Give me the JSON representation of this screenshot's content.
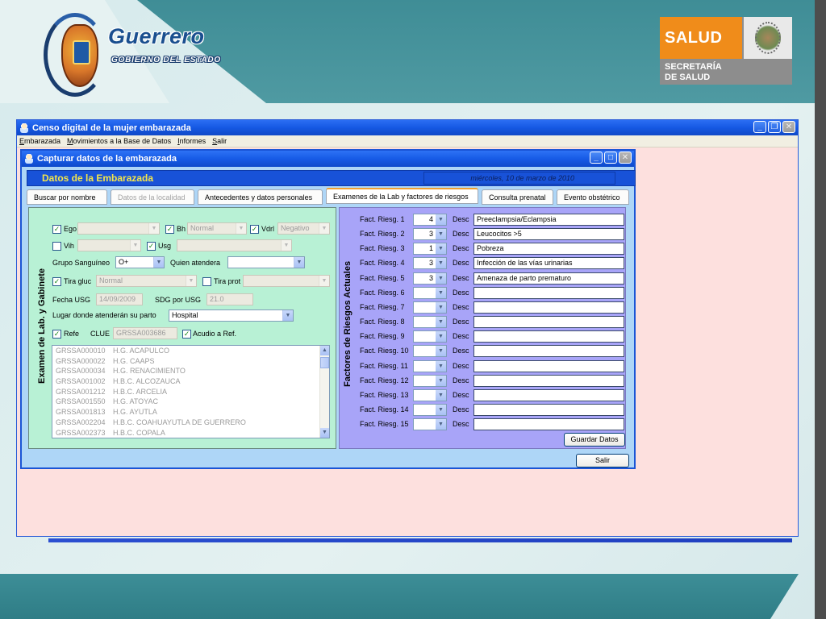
{
  "slide": {
    "guerrero_title": "Guerrero",
    "guerrero_subtitle": "GOBIERNO DEL ESTADO",
    "salud_word": "SALUD",
    "salud_secretaria_1": "SECRETARÍA",
    "salud_secretaria_2": "DE SALUD"
  },
  "main_window": {
    "title": "Censo digital de la mujer embarazada",
    "menu": [
      "Embarazada",
      "Movimientos a la Base de Datos",
      "Informes",
      "Salir"
    ]
  },
  "dialog": {
    "title": "Capturar datos de la embarazada",
    "banner_title": "Datos de la Embarazada",
    "banner_date": "miércoles, 10 de marzo de 2010",
    "tabs": [
      {
        "label": "Buscar por nombre"
      },
      {
        "label": "Datos de la localidad"
      },
      {
        "label": "Antecedentes y datos personales"
      },
      {
        "label": "Examenes de la Lab y factores de riesgos"
      },
      {
        "label": "Consulta prenatal"
      },
      {
        "label": "Evento obstétrico"
      }
    ],
    "exit_button": "Salir"
  },
  "lab": {
    "section_title": "Examen de Lab. y Gabinete",
    "ego_label": "Ego",
    "ego_checked": true,
    "ego_value": "",
    "bh_label": "Bh",
    "bh_checked": true,
    "bh_value": "Normal",
    "vdrl_label": "Vdrl",
    "vdrl_checked": true,
    "vdrl_value": "Negativo",
    "vih_label": "Vih",
    "vih_checked": false,
    "vih_value": "",
    "usg_label": "Usg",
    "usg_checked": true,
    "usg_value": "",
    "grupo_label": "Grupo Sanguíneo",
    "grupo_value": "O+",
    "quien_label": "Quien atendera",
    "quien_value": "",
    "tira_gluc_label": "Tira gluc",
    "tira_gluc_checked": true,
    "tira_gluc_value": "Normal",
    "tira_prot_label": "Tira prot",
    "tira_prot_checked": false,
    "tira_prot_value": "",
    "fecha_usg_label": "Fecha USG",
    "fecha_usg_value": "14/09/2009",
    "sdg_label": "SDG por USG",
    "sdg_value": "21.0",
    "lugar_label": "Lugar donde atenderán su parto",
    "lugar_value": "Hospital",
    "refe_label": "Refe",
    "refe_checked": true,
    "clue_label": "CLUE",
    "clue_value": "GRSSA003686",
    "acudio_label": "Acudio a Ref.",
    "acudio_checked": true,
    "hospitals": [
      {
        "code": "GRSSA000010",
        "name": "H.G. ACAPULCO"
      },
      {
        "code": "GRSSA000022",
        "name": "H.G. CAAPS"
      },
      {
        "code": "GRSSA000034",
        "name": "H.G. RENACIMIENTO"
      },
      {
        "code": "GRSSA001002",
        "name": "H.B.C. ALCOZAUCA"
      },
      {
        "code": "GRSSA001212",
        "name": "H.B.C. ARCELIA"
      },
      {
        "code": "GRSSA001550",
        "name": "H.G. ATOYAC"
      },
      {
        "code": "GRSSA001813",
        "name": "H.G. AYUTLA"
      },
      {
        "code": "GRSSA002204",
        "name": "H.B.C. COAHUAYUTLA DE GUERRERO"
      },
      {
        "code": "GRSSA002373",
        "name": "H.B.C. COPALA"
      }
    ]
  },
  "risks": {
    "section_title": "Factores de Riesgos Actuales",
    "desc_label": "Desc",
    "save_button": "Guardar Datos",
    "rows": [
      {
        "label": "Fact. Riesg. 1",
        "value": "4",
        "desc": "Preeclampsia/Eclampsia"
      },
      {
        "label": "Fact. Riesg. 2",
        "value": "3",
        "desc": "Leucocitos >5"
      },
      {
        "label": "Fact. Riesg. 3",
        "value": "1",
        "desc": "Pobreza"
      },
      {
        "label": "Fact. Riesg. 4",
        "value": "3",
        "desc": "Infección de las vías urinarias"
      },
      {
        "label": "Fact. Riesg. 5",
        "value": "3",
        "desc": "Amenaza de parto prematuro"
      },
      {
        "label": "Fact. Riesg. 6",
        "value": "",
        "desc": ""
      },
      {
        "label": "Fact. Riesg. 7",
        "value": "",
        "desc": ""
      },
      {
        "label": "Fact. Riesg. 8",
        "value": "",
        "desc": ""
      },
      {
        "label": "Fact. Riesg. 9",
        "value": "",
        "desc": ""
      },
      {
        "label": "Fact. Riesg. 10",
        "value": "",
        "desc": ""
      },
      {
        "label": "Fact. Riesg. 11",
        "value": "",
        "desc": ""
      },
      {
        "label": "Fact. Riesg. 12",
        "value": "",
        "desc": ""
      },
      {
        "label": "Fact. Riesg. 13",
        "value": "",
        "desc": ""
      },
      {
        "label": "Fact. Riesg. 14",
        "value": "",
        "desc": ""
      },
      {
        "label": "Fact. Riesg. 15",
        "value": "",
        "desc": ""
      }
    ]
  }
}
